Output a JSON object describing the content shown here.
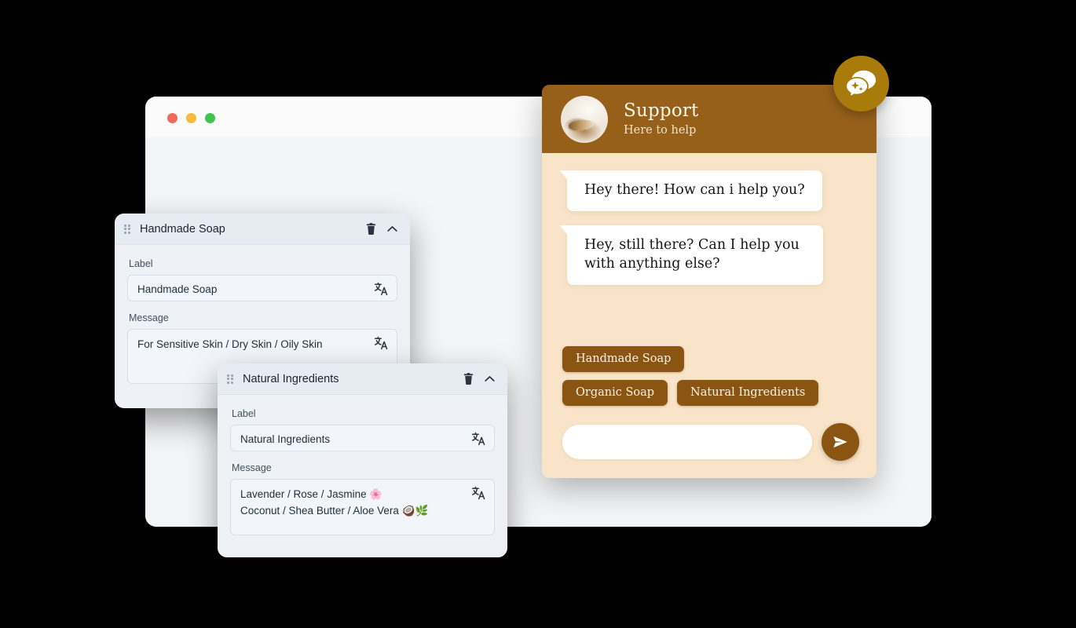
{
  "theme": {
    "page_background": "#000000",
    "brand_brown": "#96601a",
    "chip_brown": "#8a5413",
    "launcher_gold": "#a97b0a",
    "chat_body_cream": "#f9e4c9",
    "card_background": "#eef1f6"
  },
  "browser": {
    "traffic_lights": [
      {
        "name": "close",
        "color": "#ef6a5c"
      },
      {
        "name": "minimize",
        "color": "#f5bc3f"
      },
      {
        "name": "maximize",
        "color": "#3fc54b"
      }
    ]
  },
  "chat": {
    "launcher_icon": "chat-bubbles-sparkle-icon",
    "avatar_icon": "support-agent-avatar",
    "title": "Support",
    "subtitle": "Here to help",
    "messages": [
      {
        "from": "agent",
        "text": "Hey there! How can i help you?"
      },
      {
        "from": "agent",
        "text": "Hey, still there? Can I help you with anything else?"
      }
    ],
    "quick_replies_row_1": [
      {
        "label": "Handmade Soap"
      }
    ],
    "quick_replies_row_2": [
      {
        "label": "Organic Soap"
      },
      {
        "label": "Natural Ingredients"
      }
    ],
    "input": {
      "value": "",
      "placeholder": ""
    },
    "send_icon": "send-paper-plane-icon"
  },
  "cards": [
    {
      "title": "Handmade Soap",
      "drag_handle_icon": "drag-handle-icon",
      "delete_icon": "trash-icon",
      "collapse_icon": "chevron-up-icon",
      "translate_icon": "translate-icon",
      "label_field": {
        "label": "Label",
        "value": "Handmade Soap"
      },
      "message_field": {
        "label": "Message",
        "value": "For Sensitive Skin / Dry Skin / Oily Skin"
      }
    },
    {
      "title": "Natural Ingredients",
      "drag_handle_icon": "drag-handle-icon",
      "delete_icon": "trash-icon",
      "collapse_icon": "chevron-up-icon",
      "translate_icon": "translate-icon",
      "label_field": {
        "label": "Label",
        "value": "Natural Ingredients"
      },
      "message_field": {
        "label": "Message",
        "value": "Lavender / Rose / Jasmine 🌸\nCoconut / Shea Butter / Aloe Vera 🥥🌿"
      }
    }
  ]
}
